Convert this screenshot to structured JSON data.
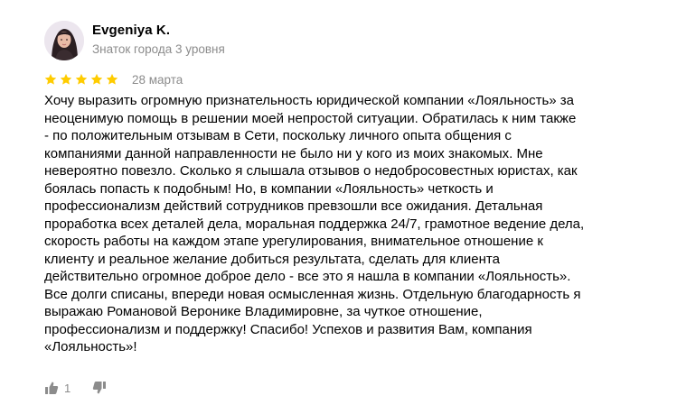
{
  "review": {
    "author": {
      "name": "Evgeniya K.",
      "status": "Знаток города 3 уровня",
      "avatar": "user-avatar-photo"
    },
    "rating": {
      "stars": 5,
      "max": 5,
      "icon": "star-icon",
      "color": "#fc0"
    },
    "date": "28 марта",
    "text_lines": [
      "Хочу выразить огромную признательность юридической компании «Лояльность» за",
      "неоценимую помощь в решении моей непростой ситуации. Обратилась к ним также",
      "- по положительным отзывам в Сети, поскольку личного опыта общения с",
      "компаниями данной направленности не было ни у кого из моих знакомых. Мне",
      "невероятно повезло. Сколько я слышала отзывов о недобросовестных юристах, как",
      "боялась попасть к подобным! Но, в компании «Лояльность» четкость и",
      "профессионализм действий сотрудников превзошли все ожидания. Детальная",
      "проработка всех деталей дела, моральная поддержка 24/7, грамотное ведение дела,",
      "скорость работы на каждом этапе урегулирования, внимательное отношение к",
      "клиенту и реальное желание добиться результата, сделать для клиента",
      "действительно огромное доброе дело - все это я нашла в компании «Лояльность».",
      "Все долги списаны, впереди новая осмысленная жизнь. Отдельную благодарность я",
      "выражаю Романовой Веронике Владимировне, за чуткое отношение,",
      "профессионализм и поддержку! Спасибо! Успехов и развития Вам, компания",
      "«Лояльность»!"
    ],
    "actions": {
      "like_icon": "thumbs-up-icon",
      "like_count": "1",
      "dislike_icon": "thumbs-down-icon"
    }
  }
}
